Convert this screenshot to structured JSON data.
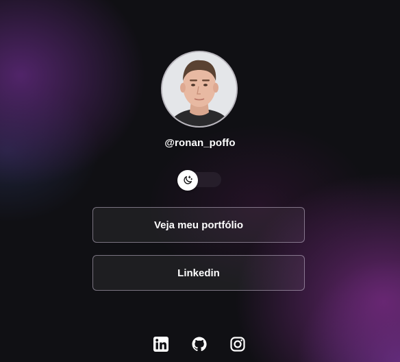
{
  "profile": {
    "username": "@ronan_poffo",
    "avatar": "profile-photo"
  },
  "theme_toggle": {
    "icon": "moon-stars-icon",
    "state": "dark"
  },
  "buttons": [
    {
      "label": "Veja meu portfólio"
    },
    {
      "label": "Linkedin"
    }
  ],
  "social_links": [
    {
      "icon": "linkedin-icon"
    },
    {
      "icon": "github-icon"
    },
    {
      "icon": "instagram-icon"
    }
  ],
  "colors": {
    "background": "#101014",
    "accent_purple": "#5c2878",
    "text": "#ffffff"
  }
}
